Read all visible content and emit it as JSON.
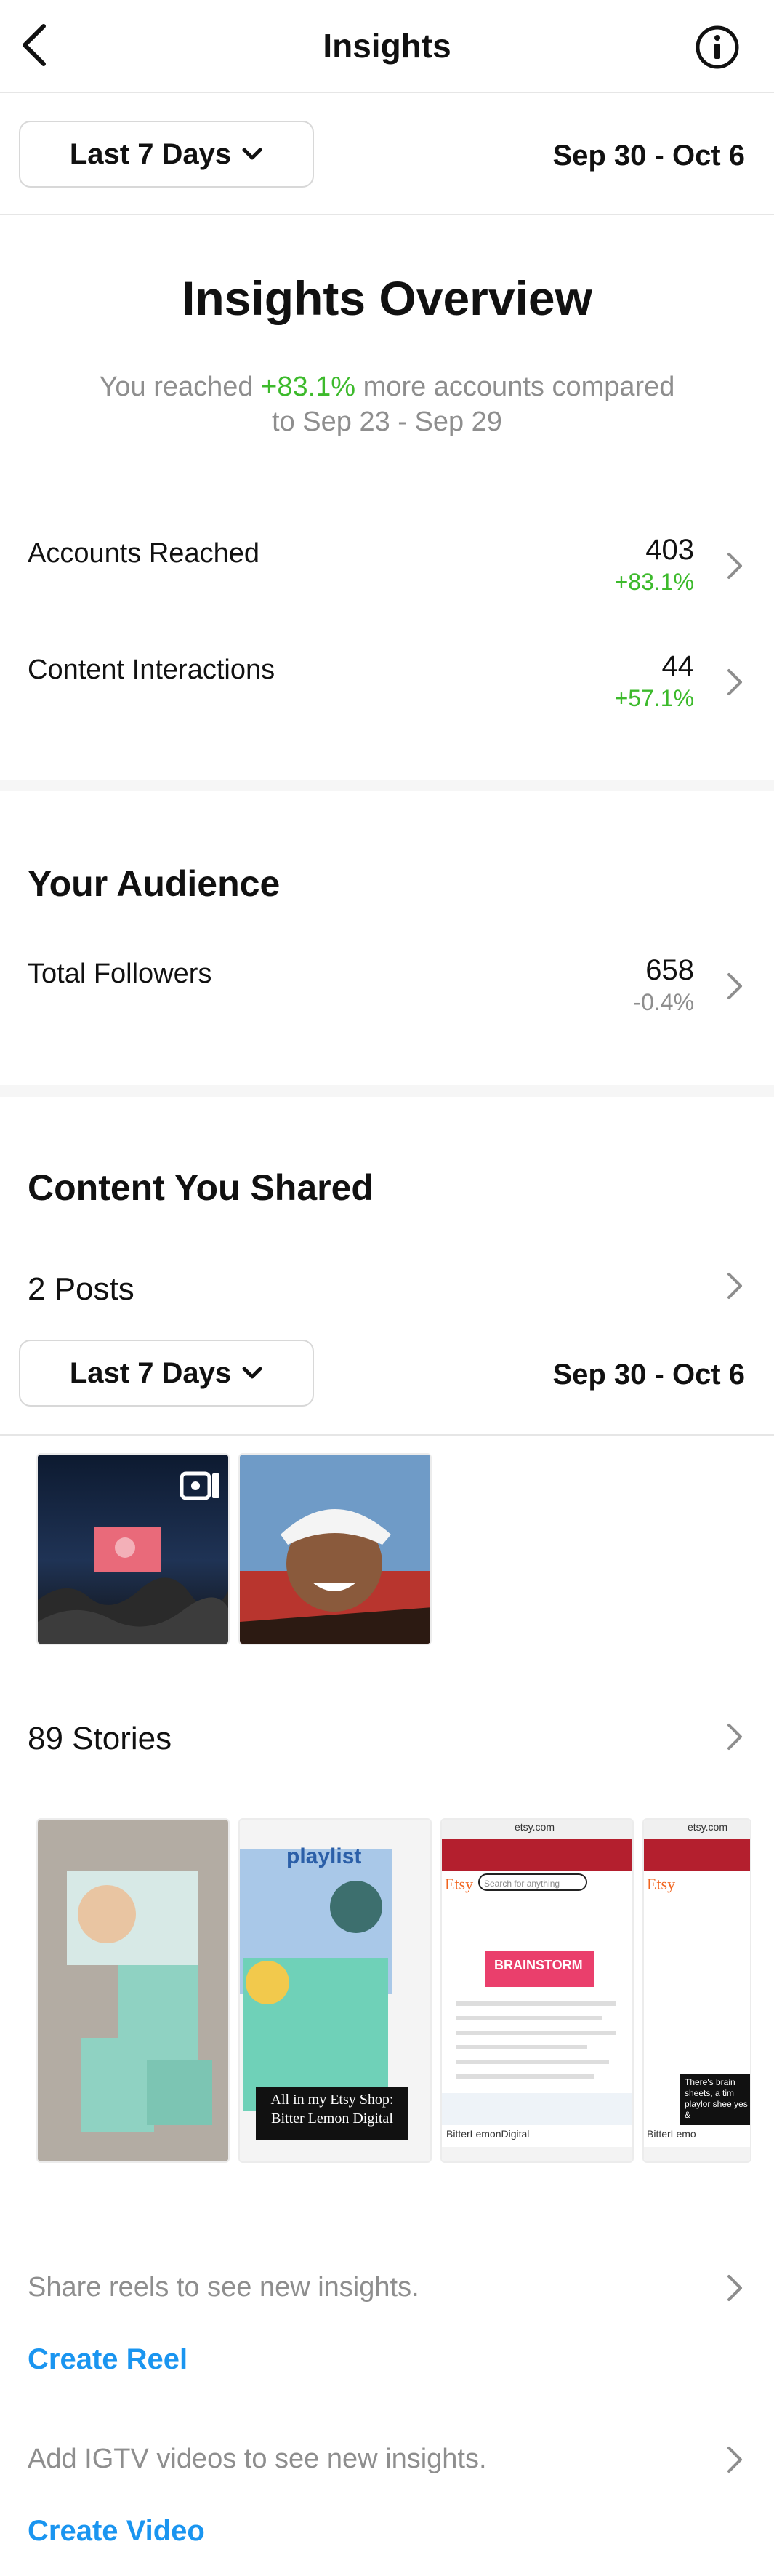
{
  "header": {
    "title": "Insights"
  },
  "filter": {
    "period_label": "Last 7 Days",
    "date_range": "Sep 30 - Oct 6"
  },
  "overview": {
    "title": "Insights Overview",
    "summary_prefix": "You reached",
    "summary_pct": "+83.1%",
    "summary_suffix": "more accounts compared",
    "summary_line2": "to Sep 23 - Sep 29",
    "metrics": [
      {
        "label": "Accounts Reached",
        "value": "403",
        "change": "+83.1%"
      },
      {
        "label": "Content Interactions",
        "value": "44",
        "change": "+57.1%"
      }
    ]
  },
  "audience": {
    "title": "Your Audience",
    "metric": {
      "label": "Total Followers",
      "value": "658",
      "change": "-0.4%"
    }
  },
  "content": {
    "title": "Content You Shared",
    "posts_label": "2 Posts",
    "stories_label": "89 Stories",
    "story_texts": {
      "story2_heading": "playlist",
      "story2_caption_line1": "All in my Etsy Shop:",
      "story2_caption_line2": "Bitter Lemon Digital",
      "story3_url": "etsy.com",
      "story3_logo": "Etsy",
      "story3_search": "Search for anything",
      "story3_banner": "BRAINSTORM",
      "story3_shop": "BitterLemonDigital",
      "story4_url": "etsy.com",
      "story4_logo": "Etsy",
      "story4_shop": "BitterLemo",
      "story4_caption": "There's brain sheets, a tim playlor shee yes &"
    }
  },
  "reels": {
    "hint": "Share reels to see new insights.",
    "action": "Create Reel"
  },
  "igtv": {
    "hint": "Add IGTV videos to see new insights.",
    "action": "Create Video"
  },
  "colors": {
    "positive": "#3dba2c",
    "link": "#1a95f0",
    "muted": "#8e8e8e"
  }
}
